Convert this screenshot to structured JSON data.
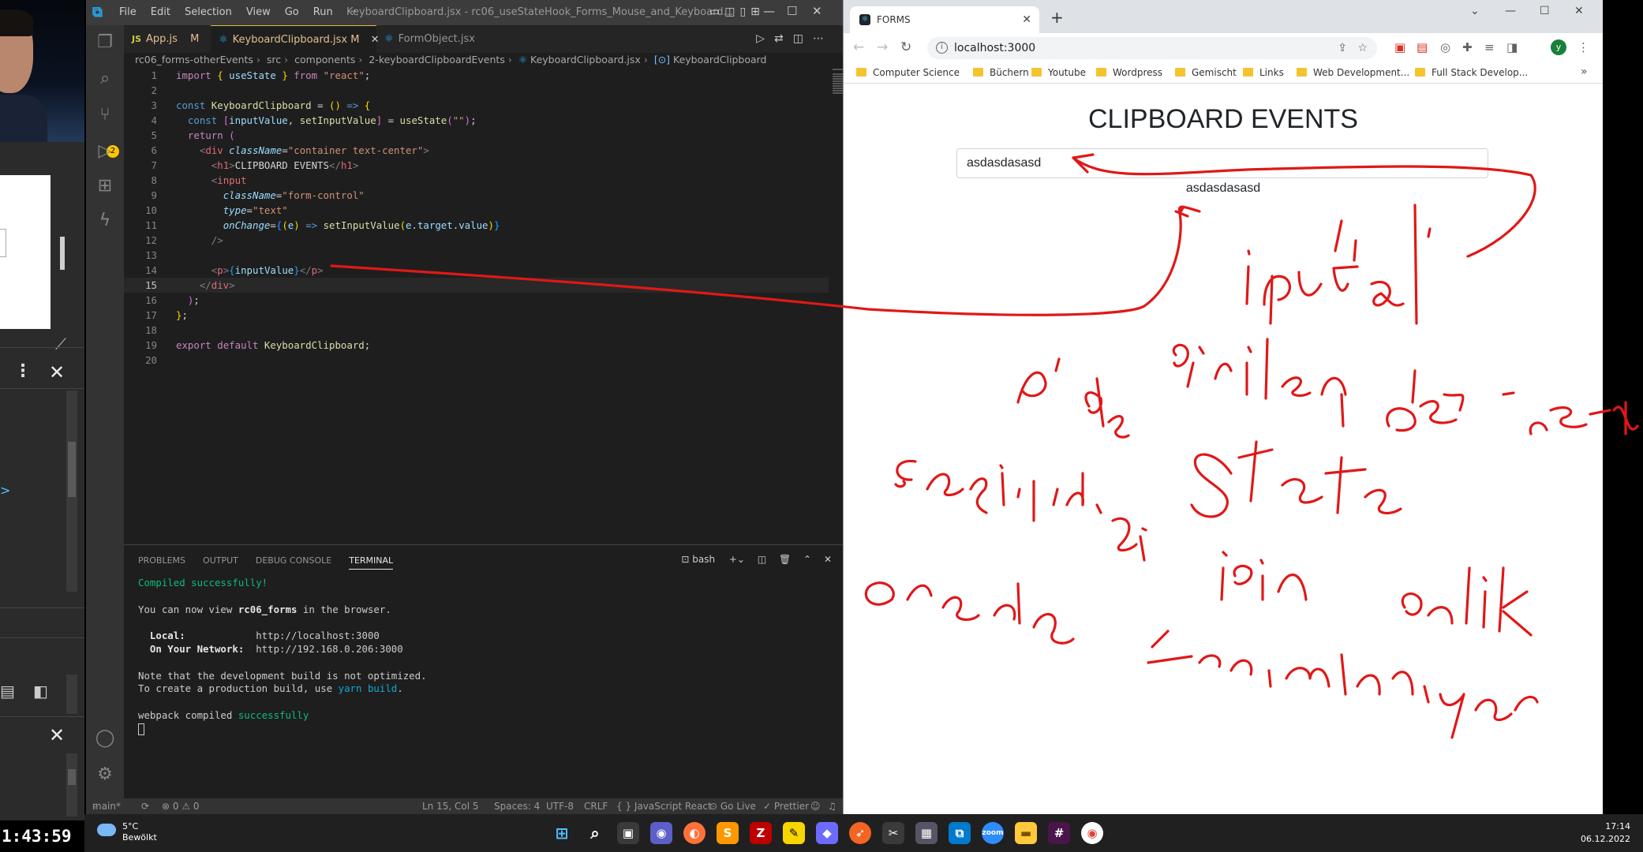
{
  "obs": {
    "clock": "1:43:59"
  },
  "vscode": {
    "menu": [
      "File",
      "Edit",
      "Selection",
      "View",
      "Go",
      "Run",
      "···"
    ],
    "window_title": "KeyboardClipboard.jsx - rc06_useStateHook_Forms_Mouse_and_Keyboard...",
    "tabs": [
      {
        "label": "App.js",
        "modified": "M",
        "icon": "js-icon"
      },
      {
        "label": "KeyboardClipboard.jsx",
        "modified": "M",
        "icon": "react-icon",
        "active": true
      },
      {
        "label": "FormObject.jsx",
        "modified": "",
        "icon": "react-icon"
      }
    ],
    "source_control_badge": "2",
    "breadcrumb": [
      "rc06_forms-otherEvents",
      "src",
      "components",
      "2-keyboardClipboardEvents",
      "KeyboardClipboard.jsx",
      "KeyboardClipboard"
    ],
    "line_numbers": [
      "1",
      "2",
      "3",
      "4",
      "5",
      "6",
      "7",
      "8",
      "9",
      "10",
      "11",
      "12",
      "13",
      "14",
      "15",
      "16",
      "17",
      "18",
      "19",
      "20"
    ],
    "current_line": 15,
    "panel": {
      "tabs": [
        "PROBLEMS",
        "OUTPUT",
        "DEBUG CONSOLE",
        "TERMINAL"
      ],
      "active_tab": "TERMINAL",
      "shell": "bash"
    },
    "terminal": {
      "compiled": "Compiled successfully!",
      "view_prefix": "You can now view ",
      "app_name": "rc06_forms",
      "view_suffix": " in the browser.",
      "local_label": "  Local:            ",
      "local_url": "http://localhost:3000",
      "network_label": "  On Your Network:  ",
      "network_url": "http://192.168.0.206:3000",
      "note1": "Note that the development build is not optimized.",
      "note2_prefix": "To create a production build, use ",
      "note2_cmd": "yarn build",
      "note2_suffix": ".",
      "webpack_prefix": "webpack compiled ",
      "webpack_status": "successfully"
    },
    "status": {
      "branch": "main*",
      "problems": "⊗ 0 ⚠ 0",
      "position": "Ln 15, Col 5",
      "spaces": "Spaces: 4",
      "encoding": "UTF-8",
      "eol": "CRLF",
      "language": "{ } JavaScript React",
      "golive": "⊙ Go Live",
      "prettier": "✓ Prettier"
    }
  },
  "chrome": {
    "tab_title": "FORMS",
    "url": "localhost:3000",
    "avatar_letter": "y",
    "bookmarks": [
      "Computer Science",
      "Büchern",
      "Youtube",
      "Wordpress",
      "Gemischt",
      "Links",
      "Web Development...",
      "Full Stack Develop..."
    ],
    "page": {
      "heading": "CLIPBOARD EVENTS",
      "input_value": "asdasdasasd",
      "paragraph": "asdasdasasd"
    }
  },
  "annotation": {
    "color": "#e01818",
    "handwriting": [
      "input'a",
      "girilen değerler",
      "p'de",
      "State",
      "çağırıldığı",
      "için",
      "orada",
      "anlık",
      "tanımlanıyor"
    ]
  },
  "taskbar": {
    "weather_temp": "5°C",
    "weather_desc": "Bewölkt",
    "time": "17:14",
    "date": "06.12.2022"
  }
}
